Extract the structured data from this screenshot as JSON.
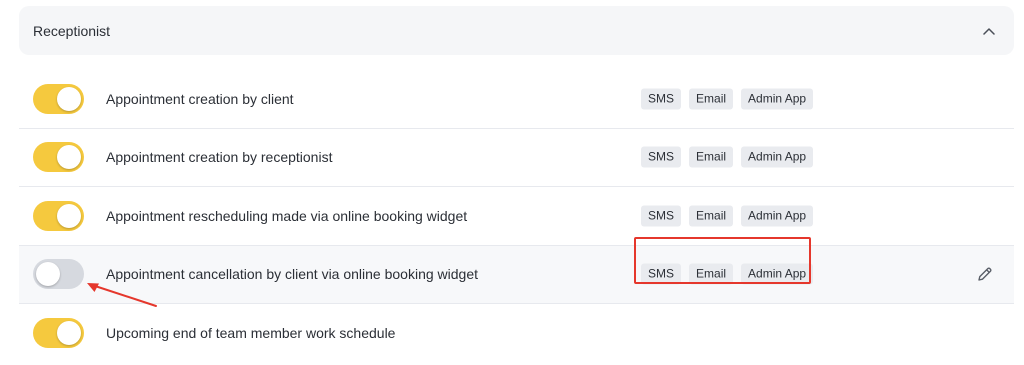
{
  "section": {
    "title": "Receptionist"
  },
  "rows": [
    {
      "label": "Appointment creation by client",
      "enabled": true,
      "channels": [
        "SMS",
        "Email",
        "Admin App"
      ]
    },
    {
      "label": "Appointment creation by receptionist",
      "enabled": true,
      "channels": [
        "SMS",
        "Email",
        "Admin App"
      ]
    },
    {
      "label": "Appointment rescheduling made via online booking widget",
      "enabled": true,
      "channels": [
        "SMS",
        "Email",
        "Admin App"
      ]
    },
    {
      "label": "Appointment cancellation by client via online booking widget",
      "enabled": false,
      "channels": [
        "SMS",
        "Email",
        "Admin App"
      ]
    },
    {
      "label": "Upcoming end of team member work schedule",
      "enabled": true,
      "channels": []
    }
  ],
  "icons": {
    "collapse": "chevron-up-icon",
    "edit": "pencil-icon"
  },
  "colors": {
    "toggle_on": "#f5c93e",
    "toggle_off": "#d6d9df",
    "annotation": "#e5372c"
  }
}
